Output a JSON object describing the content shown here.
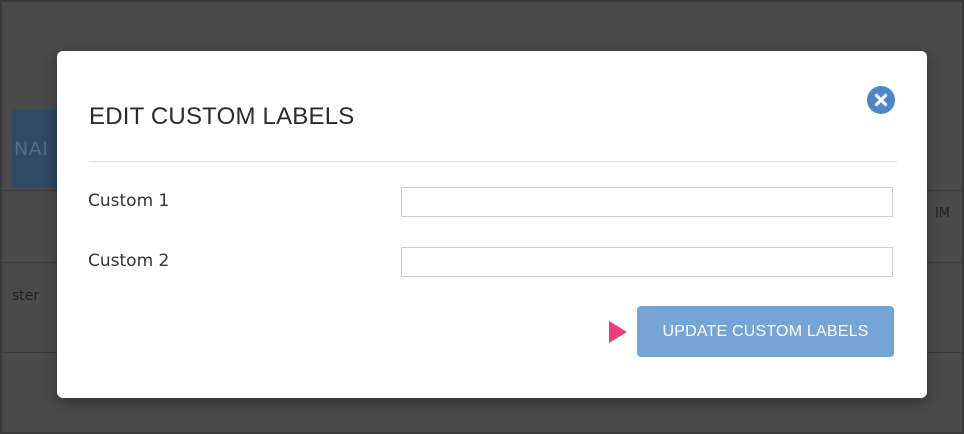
{
  "background": {
    "banner_fragment": "NAI",
    "left_fragment": "ster",
    "right_fragment": "IM"
  },
  "modal": {
    "title": "EDIT CUSTOM LABELS",
    "close_icon": "close-circle-icon",
    "fields": [
      {
        "label": "Custom 1",
        "value": "",
        "placeholder": ""
      },
      {
        "label": "Custom 2",
        "value": "",
        "placeholder": ""
      }
    ],
    "submit_label": "UPDATE CUSTOM LABELS"
  },
  "colors": {
    "overlay": "#4a4a4a",
    "accent": "#77a4d6",
    "close_button": "#4a86c8",
    "pointer": "#e83e7b"
  }
}
